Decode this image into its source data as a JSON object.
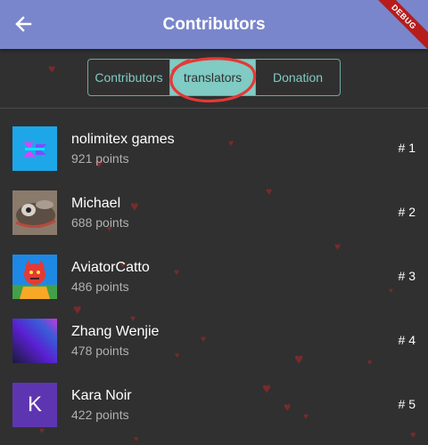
{
  "appbar": {
    "title": "Contributors",
    "debug_label": "DEBUG"
  },
  "tabs": [
    {
      "label": "Contributors"
    },
    {
      "label": "translators"
    },
    {
      "label": "Donation"
    }
  ],
  "contributors": [
    {
      "name": "nolimitex games",
      "points": "921 points",
      "rank": "# 1"
    },
    {
      "name": "Michael",
      "points": "688 points",
      "rank": "# 2"
    },
    {
      "name": "AviatorCatto",
      "points": "486 points",
      "rank": "# 3"
    },
    {
      "name": "Zhang Wenjie",
      "points": "478 points",
      "rank": "# 4"
    },
    {
      "name": "Kara Noir",
      "points": "422 points",
      "rank": "# 5",
      "initial": "K"
    }
  ],
  "colors": {
    "appbar": "#7986CB",
    "accent": "#80CBC4",
    "annotation": "#E53935",
    "heart": "#7a2a2a"
  }
}
